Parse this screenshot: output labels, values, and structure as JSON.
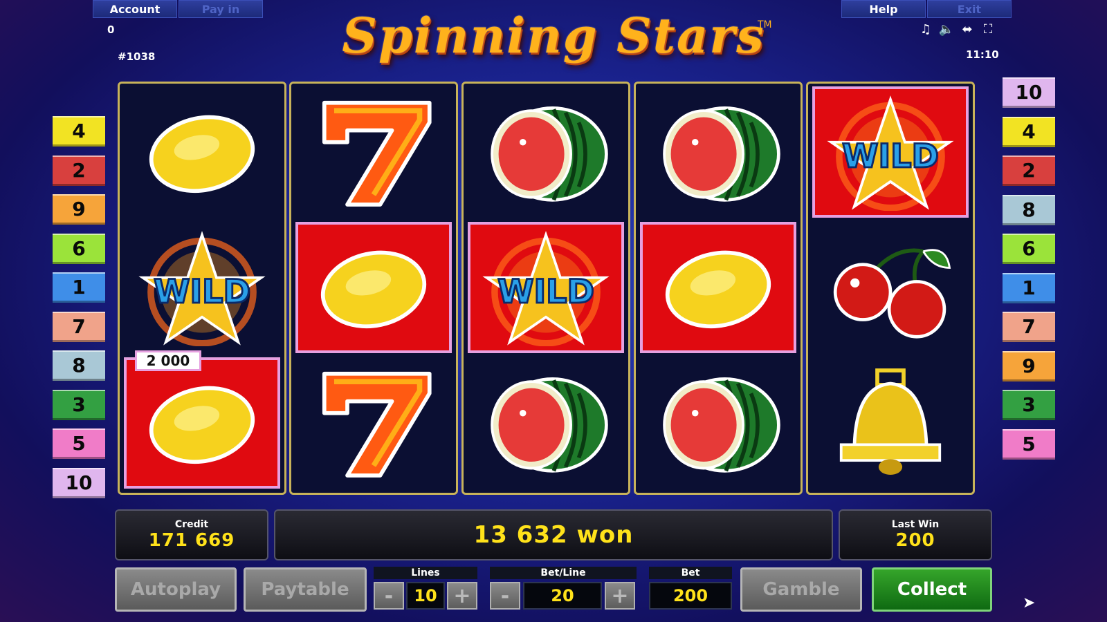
{
  "header": {
    "account_label": "Account",
    "payin_label": "Pay in",
    "help_label": "Help",
    "exit_label": "Exit",
    "balance": "0",
    "game_id": "#1038",
    "time": "11:10",
    "title": "Spinning Stars",
    "trademark": "TM",
    "icons": [
      "music-note-icon",
      "speaker-icon",
      "resize-icon",
      "fullscreen-icon"
    ]
  },
  "lines_left": [
    {
      "n": "4",
      "color": "#f2e323"
    },
    {
      "n": "2",
      "color": "#d8403e"
    },
    {
      "n": "9",
      "color": "#f6a43a"
    },
    {
      "n": "6",
      "color": "#9be33a"
    },
    {
      "n": "1",
      "color": "#3f8ee8"
    },
    {
      "n": "7",
      "color": "#f0a38a"
    },
    {
      "n": "8",
      "color": "#a9c8d6"
    },
    {
      "n": "3",
      "color": "#33a042"
    },
    {
      "n": "5",
      "color": "#f07cc8"
    },
    {
      "n": "10",
      "color": "#e0b6ee"
    }
  ],
  "lines_right": [
    {
      "n": "10",
      "color": "#e0b6ee"
    },
    {
      "n": "4",
      "color": "#f2e323"
    },
    {
      "n": "2",
      "color": "#d8403e"
    },
    {
      "n": "8",
      "color": "#a9c8d6"
    },
    {
      "n": "6",
      "color": "#9be33a"
    },
    {
      "n": "1",
      "color": "#3f8ee8"
    },
    {
      "n": "7",
      "color": "#f0a38a"
    },
    {
      "n": "9",
      "color": "#f6a43a"
    },
    {
      "n": "3",
      "color": "#33a042"
    },
    {
      "n": "5",
      "color": "#f07cc8"
    }
  ],
  "reels": [
    [
      {
        "symbol": "lemon",
        "win": false
      },
      {
        "symbol": "wild",
        "win": false
      },
      {
        "symbol": "lemon",
        "win": true
      }
    ],
    [
      {
        "symbol": "seven",
        "win": false
      },
      {
        "symbol": "lemon",
        "win": true
      },
      {
        "symbol": "seven",
        "win": false
      }
    ],
    [
      {
        "symbol": "watermelon",
        "win": false
      },
      {
        "symbol": "wild",
        "win": true
      },
      {
        "symbol": "watermelon",
        "win": false
      }
    ],
    [
      {
        "symbol": "watermelon",
        "win": false
      },
      {
        "symbol": "lemon",
        "win": true
      },
      {
        "symbol": "watermelon",
        "win": false
      }
    ],
    [
      {
        "symbol": "wild",
        "win": true
      },
      {
        "symbol": "cherries",
        "win": false
      },
      {
        "symbol": "bell",
        "win": false
      }
    ]
  ],
  "wild_text": "WILD",
  "line_win": "2 000",
  "status": {
    "credit_label": "Credit",
    "credit": "171 669",
    "message": "13 632 won",
    "last_win_label": "Last Win",
    "last_win": "200"
  },
  "controls": {
    "autoplay": "Autoplay",
    "paytable": "Paytable",
    "lines_label": "Lines",
    "lines": "10",
    "betline_label": "Bet/Line",
    "betline": "20",
    "bet_label": "Bet",
    "bet": "200",
    "minus": "-",
    "plus": "+",
    "gamble": "Gamble",
    "collect": "Collect"
  }
}
